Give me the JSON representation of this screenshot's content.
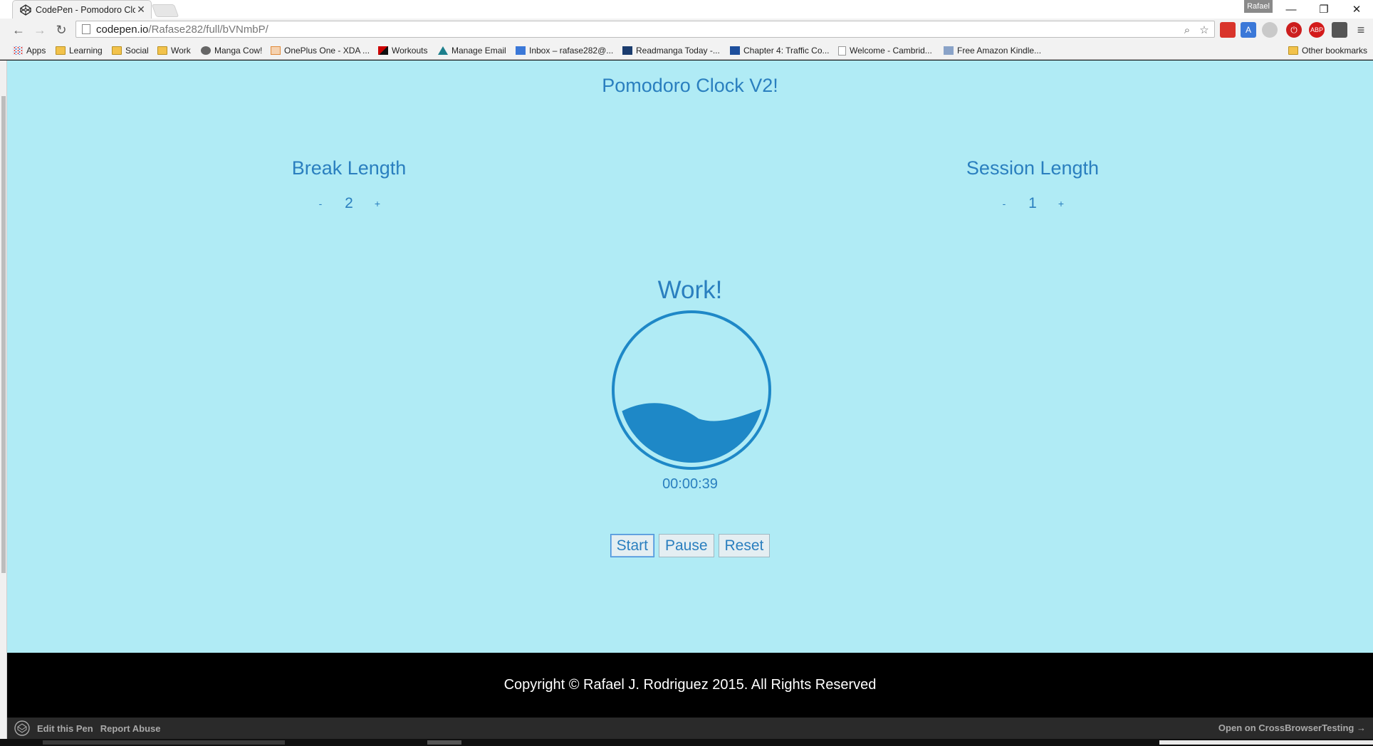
{
  "browser": {
    "tab_title": "CodePen - Pomodoro Clo",
    "tab_close": "✕",
    "profile_name": "Rafael",
    "url_host": "codepen.io",
    "url_path": "/Rafase282/full/bVNmbP/",
    "window_controls": {
      "minimize": "—",
      "restore": "❐",
      "close": "✕"
    }
  },
  "bookmarks": [
    {
      "label": "Apps",
      "icon": "apps-icon"
    },
    {
      "label": "Learning",
      "icon": "folder-icon"
    },
    {
      "label": "Social",
      "icon": "folder-icon"
    },
    {
      "label": "Work",
      "icon": "folder-icon"
    },
    {
      "label": "Manga Cow!",
      "icon": "manga-cow-icon"
    },
    {
      "label": "OnePlus One - XDA ...",
      "icon": "xda-icon"
    },
    {
      "label": "Workouts",
      "icon": "workouts-icon"
    },
    {
      "label": "Manage Email",
      "icon": "email-icon"
    },
    {
      "label": "Inbox – rafase282@...",
      "icon": "inbox-icon"
    },
    {
      "label": "Readmanga Today -...",
      "icon": "readmanga-icon"
    },
    {
      "label": "Chapter 4: Traffic Co...",
      "icon": "chapter-icon"
    },
    {
      "label": "Welcome - Cambrid...",
      "icon": "page-icon"
    },
    {
      "label": "Free Amazon Kindle...",
      "icon": "kindle-icon"
    }
  ],
  "other_bookmarks": "Other bookmarks",
  "app": {
    "title": "Pomodoro Clock V2!",
    "break": {
      "title": "Break Length",
      "minus": "-",
      "value": "2",
      "plus": "+"
    },
    "session": {
      "title": "Session Length",
      "minus": "-",
      "value": "1",
      "plus": "+"
    },
    "mode": "Work!",
    "time": "00:00:39",
    "controls": {
      "start": "Start",
      "pause": "Pause",
      "reset": "Reset"
    },
    "fill_level": 0.35
  },
  "footer": {
    "copyright": "Copyright © Rafael J. Rodriguez 2015. All Rights Reserved"
  },
  "codepen_bar": {
    "edit": "Edit this Pen",
    "report": "Report Abuse",
    "open": "Open on CrossBrowserTesting →"
  },
  "colors": {
    "accent": "#2a7fbf",
    "background": "#b0ebf5",
    "water": "#1e88c7"
  }
}
